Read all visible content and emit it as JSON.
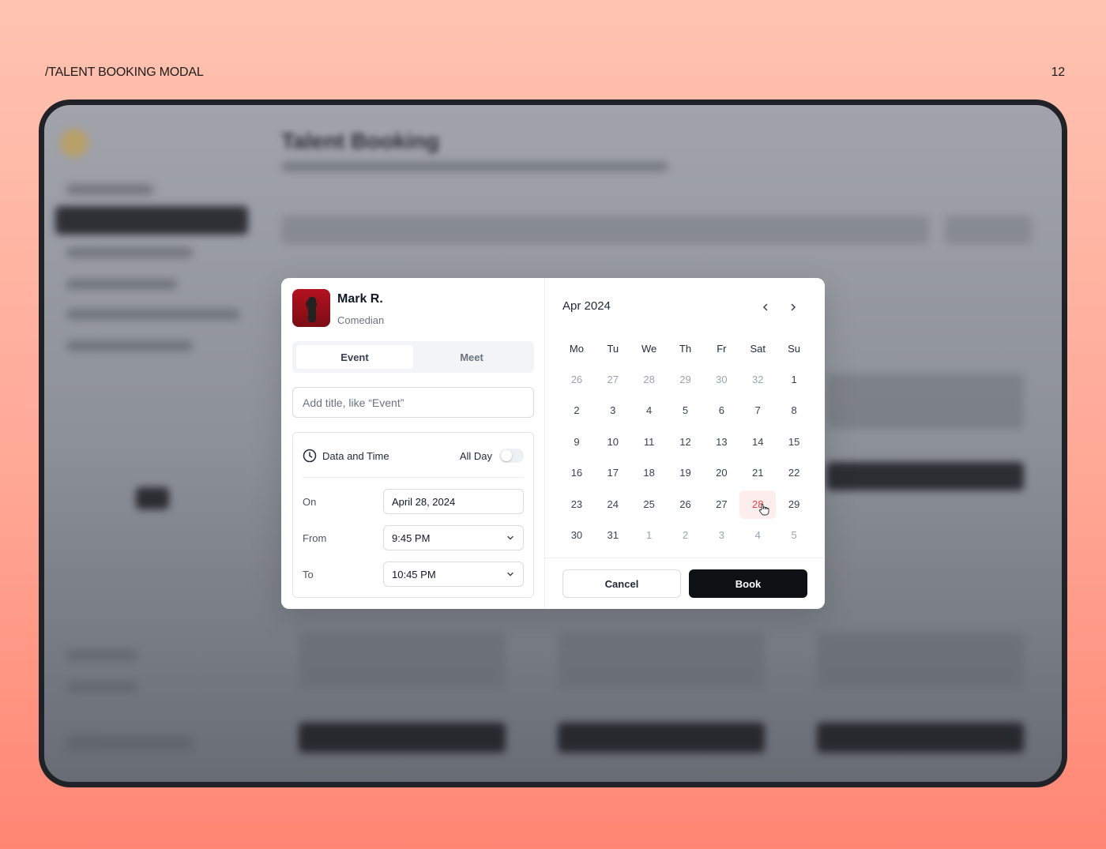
{
  "page": {
    "section_label": "/TALENT BOOKING MODAL",
    "page_number": "12"
  },
  "background_app": {
    "title": "Talent Booking"
  },
  "talent": {
    "name": "Mark R.",
    "role": "Comedian"
  },
  "tabs": [
    {
      "label": "Event",
      "active": true
    },
    {
      "label": "Meet",
      "active": false
    }
  ],
  "title_input": {
    "placeholder": "Add title, like “Event”",
    "value": ""
  },
  "datetime": {
    "heading": "Data and Time",
    "all_day_label": "All Day",
    "all_day": false,
    "on_label": "On",
    "on_value": "April 28, 2024",
    "from_label": "From",
    "from_value": "9:45 PM",
    "to_label": "To",
    "to_value": "10:45 PM"
  },
  "calendar": {
    "month": "Apr 2024",
    "weekdays": [
      "Mo",
      "Tu",
      "We",
      "Th",
      "Fr",
      "Sat",
      "Su"
    ],
    "weeks": [
      [
        [
          "26",
          1
        ],
        [
          "27",
          1
        ],
        [
          "28",
          1
        ],
        [
          "29",
          1
        ],
        [
          "30",
          1
        ],
        [
          "32",
          1
        ],
        [
          "1",
          0
        ]
      ],
      [
        [
          "2",
          0
        ],
        [
          "3",
          0
        ],
        [
          "4",
          0
        ],
        [
          "5",
          0
        ],
        [
          "6",
          0
        ],
        [
          "7",
          0
        ],
        [
          "8",
          0
        ]
      ],
      [
        [
          "9",
          0
        ],
        [
          "10",
          0
        ],
        [
          "11",
          0
        ],
        [
          "12",
          0
        ],
        [
          "13",
          0
        ],
        [
          "14",
          0
        ],
        [
          "15",
          0
        ]
      ],
      [
        [
          "16",
          0
        ],
        [
          "17",
          0
        ],
        [
          "18",
          0
        ],
        [
          "19",
          0
        ],
        [
          "20",
          0
        ],
        [
          "21",
          0
        ],
        [
          "22",
          0
        ]
      ],
      [
        [
          "23",
          0
        ],
        [
          "24",
          0
        ],
        [
          "25",
          0
        ],
        [
          "26",
          0
        ],
        [
          "27",
          0
        ],
        [
          "28",
          0
        ],
        [
          "29",
          0
        ]
      ],
      [
        [
          "30",
          0
        ],
        [
          "31",
          0
        ],
        [
          "1",
          1
        ],
        [
          "2",
          1
        ],
        [
          "3",
          1
        ],
        [
          "4",
          1
        ],
        [
          "5",
          1
        ]
      ]
    ],
    "selected": "28"
  },
  "actions": {
    "cancel": "Cancel",
    "book": "Book"
  },
  "colors": {
    "accent": "#ef4444",
    "primary": "#0d1114"
  }
}
